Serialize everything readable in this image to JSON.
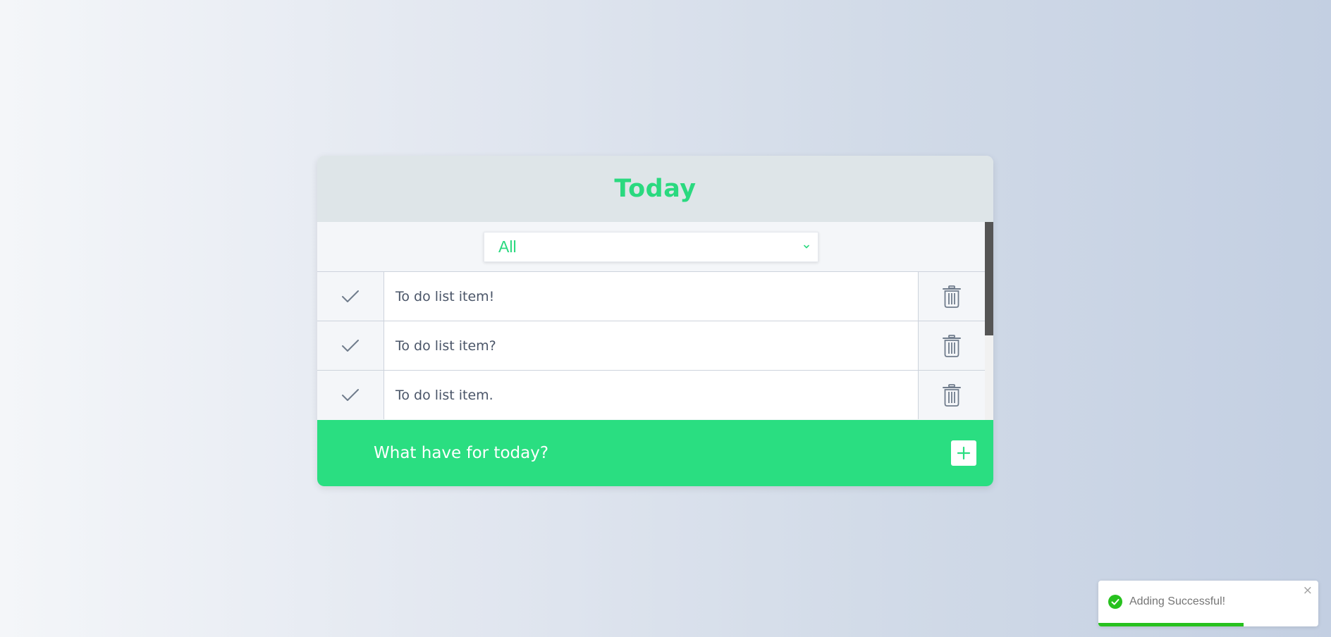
{
  "card": {
    "title": "Today"
  },
  "filter": {
    "selected": "All"
  },
  "todos": [
    {
      "text": "To do list item!"
    },
    {
      "text": "To do list item?"
    },
    {
      "text": "To do list item."
    }
  ],
  "footer": {
    "input_text": "What have for today?",
    "add_label": "+"
  },
  "toast": {
    "message": "Adding Successful!",
    "close_label": "×",
    "progress": 0.66
  },
  "colors": {
    "accent": "#2ad97f",
    "footer_bg": "#2ade81",
    "toast_success": "#27c11e"
  },
  "icons": {
    "check": "check-icon",
    "delete": "trash-icon",
    "add": "plus-icon",
    "toast": "check-circle-icon",
    "select": "chevron-down-icon"
  }
}
